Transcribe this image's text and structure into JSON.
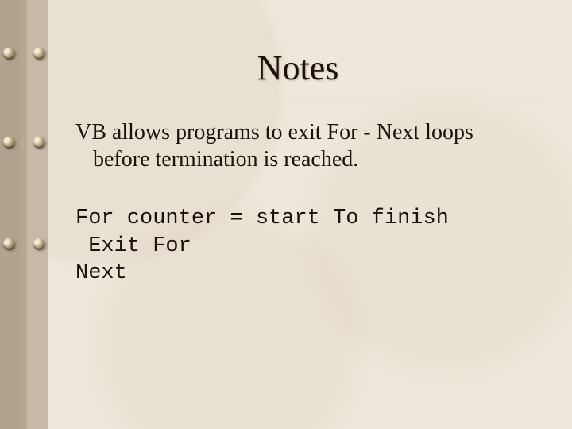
{
  "slide": {
    "title": "Notes",
    "body_line1": "VB allows programs to exit For - Next loops",
    "body_line2": "before termination is reached.",
    "code_line1": "For counter = start To finish",
    "code_line2": " Exit For",
    "code_line3": "Next"
  },
  "theme": {
    "background": "#efe7db",
    "binding": "#b3a28e",
    "text": "#1a120b"
  }
}
